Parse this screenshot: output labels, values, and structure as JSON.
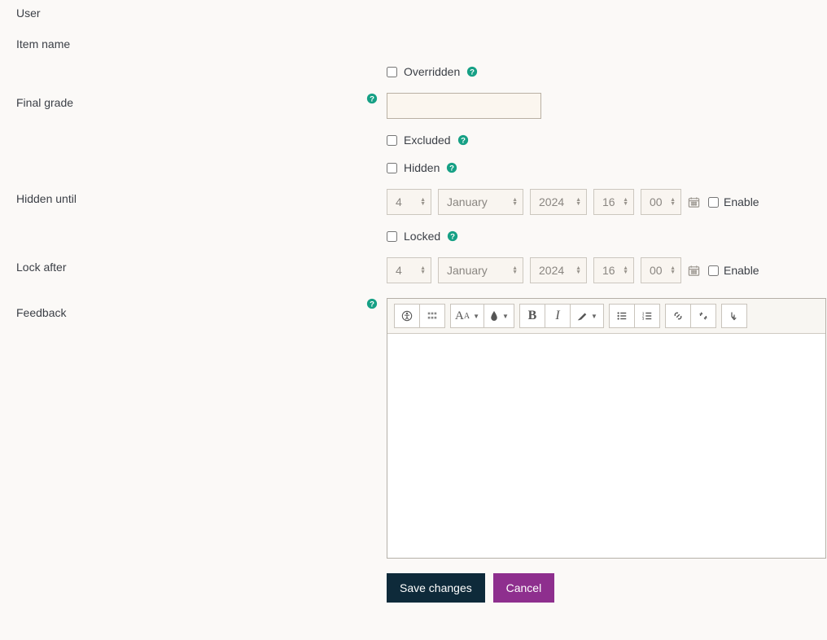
{
  "labels": {
    "user": "User",
    "item_name": "Item name",
    "final_grade": "Final grade",
    "hidden_until": "Hidden until",
    "lock_after": "Lock after",
    "feedback": "Feedback"
  },
  "checkboxes": {
    "overridden": "Overridden",
    "excluded": "Excluded",
    "hidden": "Hidden",
    "locked": "Locked",
    "enable": "Enable"
  },
  "values": {
    "user": "",
    "item_name": "",
    "final_grade": "",
    "overridden": false,
    "excluded": false,
    "hidden": false,
    "locked": false
  },
  "hidden_until": {
    "day": "4",
    "month": "January",
    "year": "2024",
    "hour": "16",
    "minute": "00",
    "enabled": false
  },
  "lock_after": {
    "day": "4",
    "month": "January",
    "year": "2024",
    "hour": "16",
    "minute": "00",
    "enabled": false
  },
  "actions": {
    "save": "Save changes",
    "cancel": "Cancel"
  }
}
